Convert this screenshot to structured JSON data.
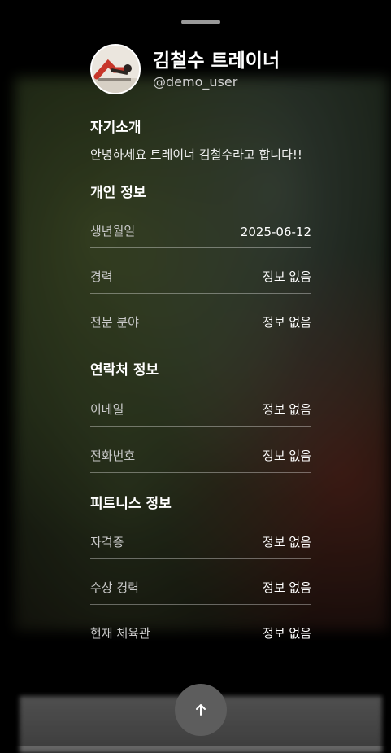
{
  "profile": {
    "name": "김철수 트레이너",
    "username": "@demo_user",
    "avatar_icon": "trainer-photo"
  },
  "intro": {
    "title": "자기소개",
    "text": "안녕하세요 트레이너 김철수라고 합니다!!"
  },
  "personal": {
    "title": "개인 정보",
    "rows": [
      {
        "label": "생년월일",
        "value": "2025-06-12"
      },
      {
        "label": "경력",
        "value": "정보 없음"
      },
      {
        "label": "전문 분야",
        "value": "정보 없음"
      }
    ]
  },
  "contact": {
    "title": "연락처 정보",
    "rows": [
      {
        "label": "이메일",
        "value": "정보 없음"
      },
      {
        "label": "전화번호",
        "value": "정보 없음"
      }
    ]
  },
  "fitness": {
    "title": "피트니스 정보",
    "rows": [
      {
        "label": "자격증",
        "value": "정보 없음"
      },
      {
        "label": "수상 경력",
        "value": "정보 없음"
      },
      {
        "label": "현재 체육관",
        "value": "정보 없음"
      }
    ]
  },
  "scroll_top_icon": "arrow-up-icon"
}
